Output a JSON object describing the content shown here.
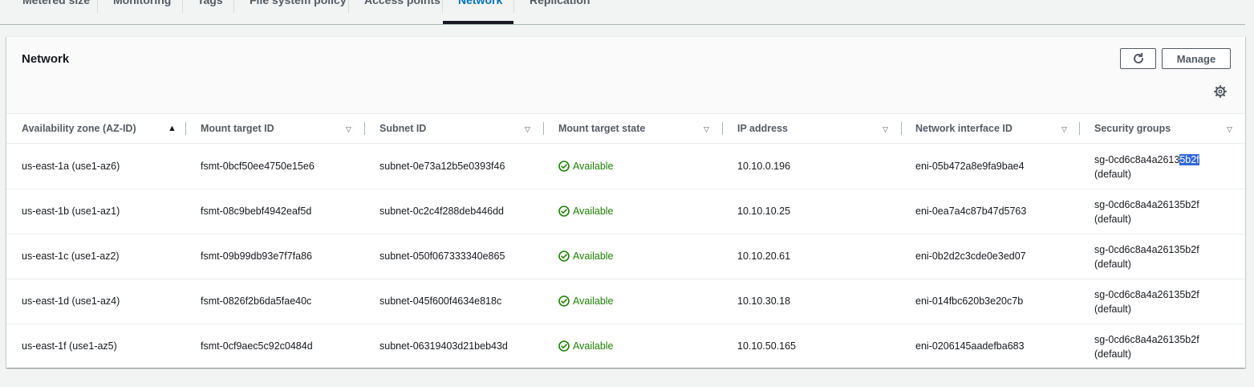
{
  "tabs": [
    {
      "label": "Metered size"
    },
    {
      "label": "Monitoring"
    },
    {
      "label": "Tags"
    },
    {
      "label": "File system policy"
    },
    {
      "label": "Access points"
    },
    {
      "label": "Network",
      "active": true
    },
    {
      "label": "Replication"
    }
  ],
  "panel": {
    "title": "Network",
    "refresh_icon": "refresh-icon",
    "manage_label": "Manage",
    "settings_icon": "gear-icon"
  },
  "table": {
    "columns": [
      {
        "label": "Availability zone (AZ-ID)",
        "sort": "ascending"
      },
      {
        "label": "Mount target ID",
        "sort": "none"
      },
      {
        "label": "Subnet ID",
        "sort": "none"
      },
      {
        "label": "Mount target state",
        "sort": "none"
      },
      {
        "label": "IP address",
        "sort": "none"
      },
      {
        "label": "Network interface ID",
        "sort": "none"
      },
      {
        "label": "Security groups",
        "sort": "none"
      }
    ],
    "rows": [
      {
        "az": "us-east-1a (use1-az6)",
        "mount_target": "fsmt-0bcf50ee4750e15e6",
        "subnet": "subnet-0e73a12b5e0393f46",
        "state": "Available",
        "ip": "10.10.0.196",
        "eni": "eni-05b472a8e9fa9bae4",
        "sg_prefix": "sg-0cd6c8a4a2613",
        "sg_selected": "5b2f",
        "sg_suffix": "(default)"
      },
      {
        "az": "us-east-1b (use1-az1)",
        "mount_target": "fsmt-08c9bebf4942eaf5d",
        "subnet": "subnet-0c2c4f288deb446dd",
        "state": "Available",
        "ip": "10.10.10.25",
        "eni": "eni-0ea7a4c87b47d5763",
        "sg": "sg-0cd6c8a4a26135b2f",
        "sg_suffix": "(default)"
      },
      {
        "az": "us-east-1c (use1-az2)",
        "mount_target": "fsmt-09b99db93e7f7fa86",
        "subnet": "subnet-050f067333340e865",
        "state": "Available",
        "ip": "10.10.20.61",
        "eni": "eni-0b2d2c3cde0e3ed07",
        "sg": "sg-0cd6c8a4a26135b2f",
        "sg_suffix": "(default)"
      },
      {
        "az": "us-east-1d (use1-az4)",
        "mount_target": "fsmt-0826f2b6da5fae40c",
        "subnet": "subnet-045f600f4634e818c",
        "state": "Available",
        "ip": "10.10.30.18",
        "eni": "eni-014fbc620b3e20c7b",
        "sg": "sg-0cd6c8a4a26135b2f",
        "sg_suffix": "(default)"
      },
      {
        "az": "us-east-1f (use1-az5)",
        "mount_target": "fsmt-0cf9aec5c92c0484d",
        "subnet": "subnet-06319403d21beb43d",
        "state": "Available",
        "ip": "10.10.50.165",
        "eni": "eni-0206145aadefba683",
        "sg": "sg-0cd6c8a4a26135b2f",
        "sg_suffix": "(default)"
      }
    ]
  },
  "colors": {
    "accent": "#0073bb",
    "available": "#1d8102",
    "selection": "#3367d6"
  }
}
